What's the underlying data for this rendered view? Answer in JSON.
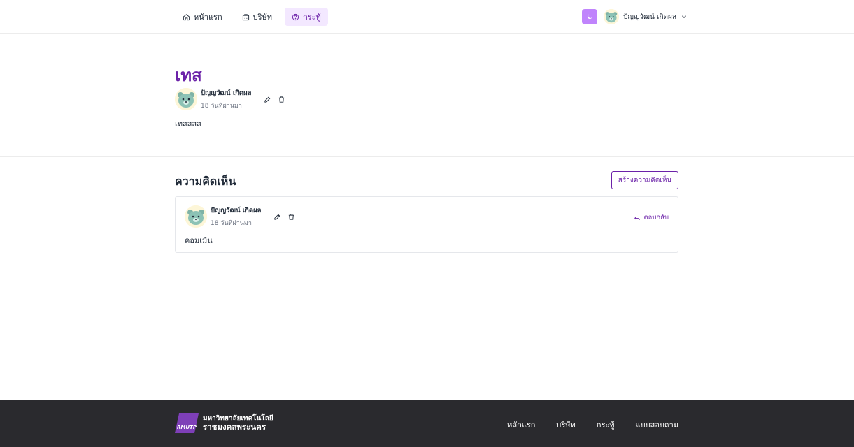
{
  "header": {
    "nav": [
      {
        "label": "หน้าแรก",
        "icon": "home-icon",
        "active": false
      },
      {
        "label": "บริษัท",
        "icon": "building-icon",
        "active": false
      },
      {
        "label": "กระทู้",
        "icon": "question-icon",
        "active": true
      }
    ],
    "theme_icon": "moon-icon",
    "user": {
      "name": "ปัญญวัฒน์ เกิดผล"
    }
  },
  "post": {
    "title": "เทส",
    "author": "ปัญญวัฒน์ เกิดผล",
    "time": "18 วันที่ผ่านมา",
    "body": "เทสสสส"
  },
  "comments": {
    "title": "ความคิดเห็น",
    "create_label": "สร้างความคิดเห็น",
    "items": [
      {
        "author": "ปัญญวัฒน์ เกิดผล",
        "time": "18 วันที่ผ่านมา",
        "body": "คอมเม้น",
        "reply_label": "ตอบกลับ"
      }
    ]
  },
  "footer": {
    "logo_abbr": "RMUTP",
    "logo_line1": "มหาวิทยาลัยเทคโนโลยี",
    "logo_line2": "ราชมงคลพระนคร",
    "links": [
      "หลักแรก",
      "บริษัท",
      "กระทู้",
      "แบบสอบถาม"
    ]
  },
  "colors": {
    "accent": "#6b21a8",
    "accent_soft": "#f3e8ff",
    "theme_button": "#c084fc",
    "footer_bg": "#2a2a2e"
  }
}
